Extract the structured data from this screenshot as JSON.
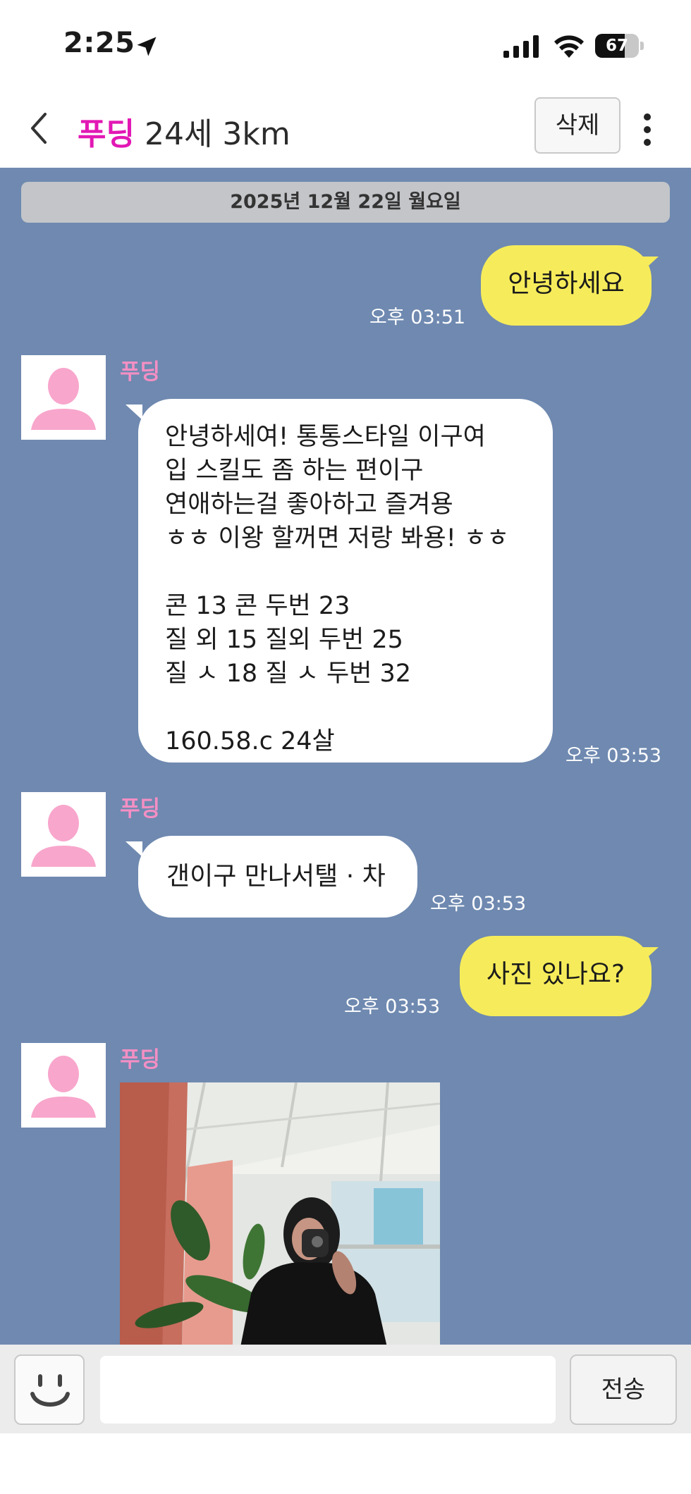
{
  "status_bar": {
    "time": "2:25",
    "battery_percent": 67,
    "battery_label": "67",
    "icons": [
      "location-arrow-icon",
      "cellular-signal-icon",
      "wifi-icon",
      "battery-icon"
    ]
  },
  "header": {
    "name": "푸딩",
    "info": " 24세 3km",
    "delete_label": "삭제",
    "icons": [
      "back-chevron-icon",
      "more-vertical-icon"
    ]
  },
  "chat": {
    "date": "2025년 12월 22일 월요일",
    "messages": [
      {
        "from": "me",
        "text": "안녕하세요",
        "time": "오후 03:51"
      },
      {
        "from": "them",
        "sender": "푸딩",
        "text": "안녕하세여! 통통스타일 이구여\n입 스킬도 좀 하는 편이구\n연애하는걸 좋아하고 즐겨용\nㅎㅎ 이왕 할꺼면 저랑 봐용! ㅎㅎ\n\n콘 13 콘 두번 23\n질 외 15 질외 두번 25\n질 ㅅ 18 질  ㅅ 두번 32\n\n160.58.c 24살",
        "time": "오후 03:53"
      },
      {
        "from": "them",
        "sender": "푸딩",
        "text": "갠이구 만나서탤 · 차",
        "time": "오후 03:53"
      },
      {
        "from": "me",
        "text": "사진 있나요?",
        "time": "오후 03:53"
      },
      {
        "from": "them",
        "sender": "푸딩",
        "type": "photo"
      }
    ]
  },
  "input": {
    "placeholder": "",
    "send_label": "전송"
  },
  "colors": {
    "chat_background": "#6f89b0",
    "my_bubble": "#f6ec5b",
    "their_bubble": "#ffffff",
    "name_accent": "#e218b4",
    "sender_name": "#f48fc4",
    "avatar_silhouette": "#f8a6cc"
  }
}
